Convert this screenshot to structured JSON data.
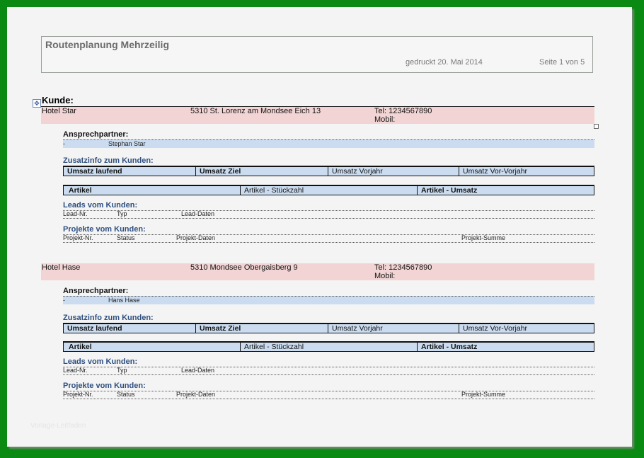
{
  "header": {
    "title": "Routenplanung Mehrzeilig",
    "printed": "gedruckt 20. Mai 2014",
    "page": "Seite 1 von 5"
  },
  "kunde_label": "Kunde:",
  "labels": {
    "contact": "Ansprechpartner:",
    "extra_info": "Zusatzinfo zum Kunden:",
    "leads": "Leads vom Kunden:",
    "projects": "Projekte vom Kunden:"
  },
  "sales_columns": [
    "Umsatz laufend",
    "Umsatz Ziel",
    "Umsatz Vorjahr",
    "Umsatz Vor-Vorjahr"
  ],
  "article_columns": [
    "Artikel",
    "Artikel - Stückzahl",
    "Artikel - Umsatz"
  ],
  "lead_columns": [
    "Lead-Nr.",
    "Typ",
    "Lead-Daten"
  ],
  "project_columns": [
    "Projekt-Nr.",
    "Status",
    "Projekt-Daten",
    "Projekt-Summe"
  ],
  "customers": [
    {
      "name": "Hotel Star",
      "address": "5310 St. Lorenz am Mondsee Eich 13",
      "tel": "Tel: 1234567890",
      "mobil": "Mobil:",
      "contact_dash": "-",
      "contact_name": "Stephan Star"
    },
    {
      "name": "Hotel Hase",
      "address": "5310 Mondsee Obergaisberg 9",
      "tel": "Tel: 1234567890",
      "mobil": "Mobil:",
      "contact_dash": "-",
      "contact_name": "Hans Hase"
    }
  ],
  "watermark": "Vorlage-Leitfaden"
}
